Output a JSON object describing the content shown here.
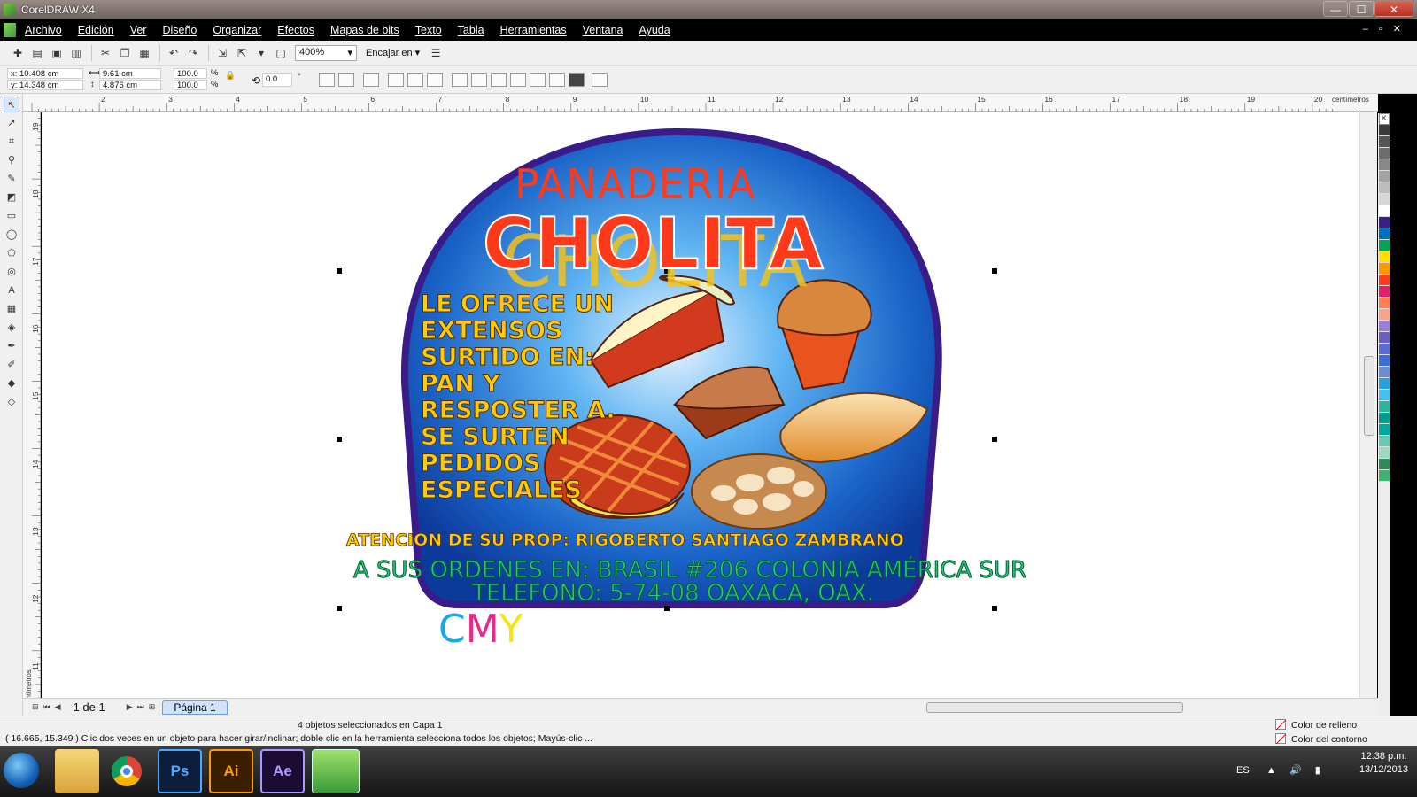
{
  "window": {
    "title": "CorelDRAW X4",
    "min": "—",
    "max": "☐",
    "close": "✕"
  },
  "menu": [
    "Archivo",
    "Edición",
    "Ver",
    "Diseño",
    "Organizar",
    "Efectos",
    "Mapas de bits",
    "Texto",
    "Tabla",
    "Herramientas",
    "Ventana",
    "Ayuda"
  ],
  "toolbar": {
    "zoom": "400%",
    "snap_label": "Encajar en"
  },
  "properties": {
    "x": "x: 10.408 cm",
    "y": "y: 14.348 cm",
    "w": "9.61 cm",
    "h": "4.876 cm",
    "sx": "100.0",
    "sy": "100.0",
    "pct": "%",
    "angle": "0.0",
    "deg": "°"
  },
  "ruler": {
    "unit": "centímetros",
    "h_ticks": [
      "2",
      "3",
      "4",
      "5",
      "6",
      "7",
      "8",
      "9",
      "10",
      "11",
      "12",
      "13",
      "14",
      "15",
      "16",
      "17",
      "18",
      "19",
      "20"
    ],
    "v_ticks": [
      "19",
      "18",
      "17",
      "16",
      "15",
      "14",
      "13",
      "12",
      "11"
    ],
    "v_unit": "centímetros"
  },
  "artwork": {
    "line1": "PANADERIA",
    "line2": "CHOLITA",
    "offer": [
      "LE OFRECE UN",
      "EXTENSOS",
      "SURTIDO EN:",
      "PAN Y",
      "RESPOSTER A.",
      "SE SURTEN",
      "PEDIDOS",
      "ESPECIALES"
    ],
    "attention": "ATENCION DE SU PROP: RIGOBERTO SANTIAGO ZAMBRANO",
    "address": "A SUS ORDENES EN:  BRASIL #206 COLONIA  AMÉRICA SUR",
    "phone": "TELEFONO:  5-74-08   OAXACA, OAX.",
    "cmy": [
      "C",
      "M",
      "Y"
    ]
  },
  "pagebar": {
    "count": "1 de 1",
    "tab": "Página 1"
  },
  "status": {
    "selection": "4 objetos seleccionados en Capa 1",
    "hint": "( 16.665, 15.349 )   Clic dos veces en un objeto para hacer girar/inclinar; doble clic en la herramienta selecciona todos los objetos; Mayús-clic ...",
    "fill": "Color de relleno",
    "outline": "Color del contorno"
  },
  "taskbar": {
    "apps": [
      "Ps",
      "Ai",
      "Ae"
    ],
    "lang": "ES",
    "time": "12:38 p.m.",
    "date": "13/12/2013"
  },
  "palette_colors": [
    "#3a3a3a",
    "#555",
    "#6d6d6d",
    "#888",
    "#a3a3a3",
    "#bdbdbd",
    "#d6d6d6",
    "#ffffff",
    "#3a1f8a",
    "#0070c0",
    "#00a651",
    "#ffe000",
    "#ff9900",
    "#ff3b1f",
    "#e0206a",
    "#ff7f50",
    "#f4a58a",
    "#9b7fd4",
    "#6c5cc7",
    "#5a6bd6",
    "#3b6fd6",
    "#6f8bd8",
    "#2a9fe0",
    "#47c0f0",
    "#2bb5a0",
    "#009b8d",
    "#00a99d",
    "#6cc8b5",
    "#9ed9c2",
    "#2e8b57",
    "#3cb371"
  ]
}
